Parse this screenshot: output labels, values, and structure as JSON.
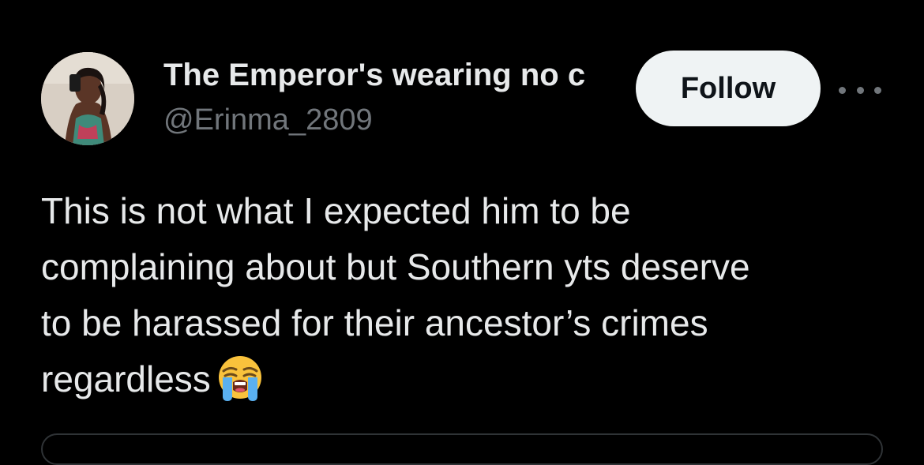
{
  "author": {
    "display_name": "The Emperor's wearing no c",
    "handle": "@Erinma_2809"
  },
  "header": {
    "follow_label": "Follow",
    "more_icon": "more-horizontal-icon"
  },
  "tweet": {
    "lines": [
      "This is not what I expected him to be",
      "complaining about but Southern yts deserve",
      "to be harassed for their ancestor’s crimes",
      "regardless"
    ],
    "emoji": "loudly-crying-face"
  },
  "colors": {
    "background": "#000000",
    "primary_text": "#e7e9ea",
    "secondary_text": "#71767b",
    "follow_bg": "#eff3f4",
    "follow_text": "#0f1419",
    "border": "#2f3336"
  }
}
